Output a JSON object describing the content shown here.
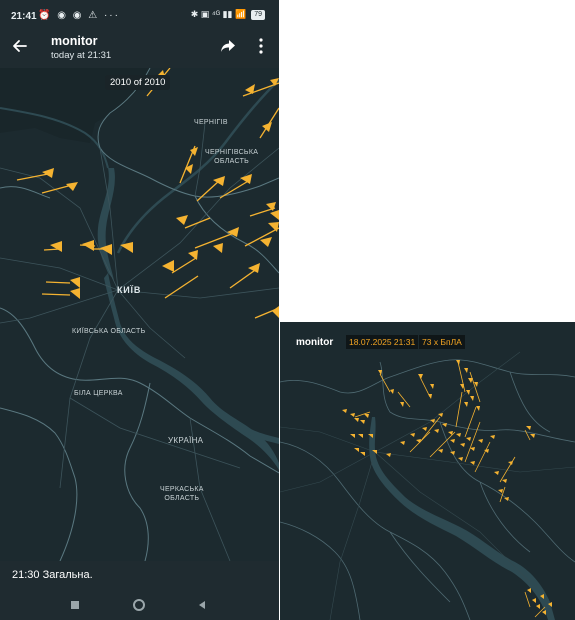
{
  "status_bar": {
    "time": "21:41",
    "left_icons": [
      "alarm-off-icon",
      "messenger-icon",
      "messenger-icon",
      "warning-icon",
      "more-dots-icon"
    ],
    "left_icons_text": "⏰ ◉ ◉ ⚠ ···",
    "right_icons_text": "✱ ▣ ⁴ᴳ ▮▮ 📶",
    "battery": "79"
  },
  "app_bar": {
    "title": "monitor",
    "subtitle": "today at 21:31"
  },
  "map_left": {
    "counter": "2010 of 2010",
    "labels": {
      "chernihiv": "ЧЕРНІГІВ",
      "chernihiv_oblast": "ЧЕРНІГІВСЬКА\nОБЛАСТЬ",
      "kyiv": "КИЇВ",
      "kyiv_oblast": "КИЇВСЬКА ОБЛАСТЬ",
      "bila_tserkva": "БІЛА ЦЕРКВА",
      "ukraine": "УКРАЇНА",
      "cherkasy_oblast": "ЧЕРКАСЬКА\nОБЛАСТЬ"
    }
  },
  "caption": "21:30 Загальна.",
  "nav_bar": [
    "recents-square-icon",
    "home-circle-icon",
    "back-triangle-icon"
  ],
  "panel_right": {
    "title": "monitor",
    "date": "18.07.2025 21:31",
    "count": "73 х БпЛА"
  },
  "colors": {
    "map_bg": "#1c2a2f",
    "river": "#2e4a52",
    "border": "#4f6a72",
    "drone": "#f5b331",
    "accent": "#f5a623"
  }
}
